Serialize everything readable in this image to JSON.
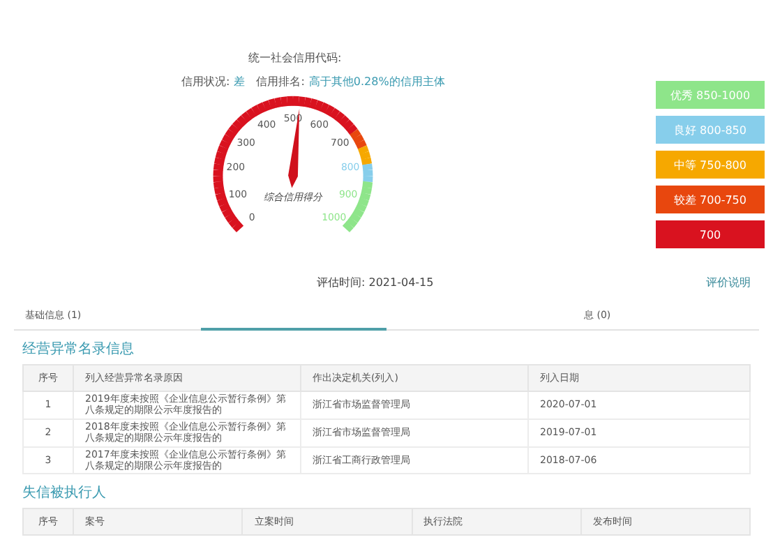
{
  "header": {
    "code_label": "统一社会信用代码:",
    "status_label": "信用状况:",
    "status_value": "差",
    "rank_label": "信用排名:",
    "rank_value": "高于其他0.28%的信用主体"
  },
  "gauge": {
    "caption": "综合信用得分",
    "labels": [
      "0",
      "100",
      "200",
      "300",
      "400",
      "500",
      "600",
      "700",
      "800",
      "900",
      "1000"
    ]
  },
  "legend": [
    {
      "label": "优秀 850-1000",
      "color": "#8ee58a"
    },
    {
      "label": "良好 800-850",
      "color": "#87ceeb"
    },
    {
      "label": "中等 750-800",
      "color": "#f6a800"
    },
    {
      "label": "较差 700-750",
      "color": "#e8470e"
    },
    {
      "label": "700",
      "color": "#d9121f"
    }
  ],
  "eval_time": "评估时间: 2021-04-15",
  "eval_link": "评价说明",
  "tabs": [
    {
      "label": "基础信息 (1)",
      "selected": false
    },
    {
      "selected": true
    },
    {
      "selected": false
    },
    {
      "label": "息 (0)",
      "selected": false
    }
  ],
  "sections": [
    {
      "title": "经营异常名录信息",
      "columns": [
        "序号",
        "列入经营异常名录原因",
        "作出决定机关(列入)",
        "列入日期"
      ],
      "rows": [
        [
          "1",
          "2019年度未按照《企业信息公示暂行条例》第八条规定的期限公示年度报告的",
          "浙江省市场监督管理局",
          "2020-07-01"
        ],
        [
          "2",
          "2018年度未按照《企业信息公示暂行条例》第八条规定的期限公示年度报告的",
          "浙江省市场监督管理局",
          "2019-07-01"
        ],
        [
          "3",
          "2017年度未按照《企业信息公示暂行条例》第八条规定的期限公示年度报告的",
          "浙江省工商行政管理局",
          "2018-07-06"
        ]
      ]
    },
    {
      "title": "失信被执行人",
      "columns": [
        "序号",
        "案号",
        "立案时间",
        "执行法院",
        "发布时间"
      ]
    }
  ]
}
